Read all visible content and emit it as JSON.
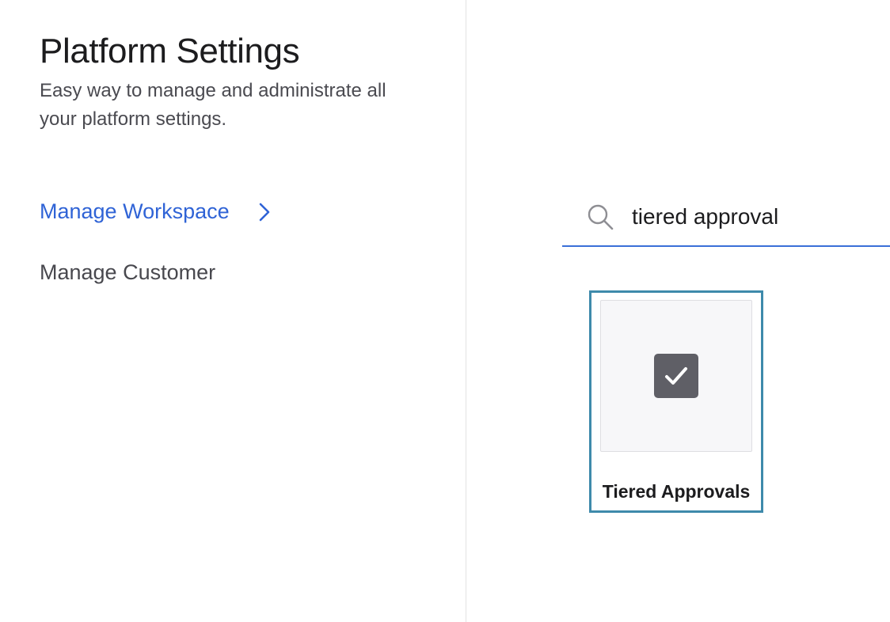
{
  "header": {
    "title": "Platform Settings",
    "subtitle": "Easy way to manage and administrate all your platform settings."
  },
  "nav": {
    "items": [
      {
        "label": "Manage Workspace",
        "active": true,
        "icon": "chevron-right-icon"
      },
      {
        "label": "Manage Customer",
        "active": false
      }
    ]
  },
  "search": {
    "icon": "search-icon",
    "value": "tiered approval",
    "placeholder": ""
  },
  "results": [
    {
      "label": "Tiered Approvals",
      "icon": "checkbox-checked-icon",
      "selected": true
    }
  ],
  "colors": {
    "accent": "#2f63d6",
    "card_border": "#3e8aab",
    "icon_bg": "#5f5f66"
  }
}
